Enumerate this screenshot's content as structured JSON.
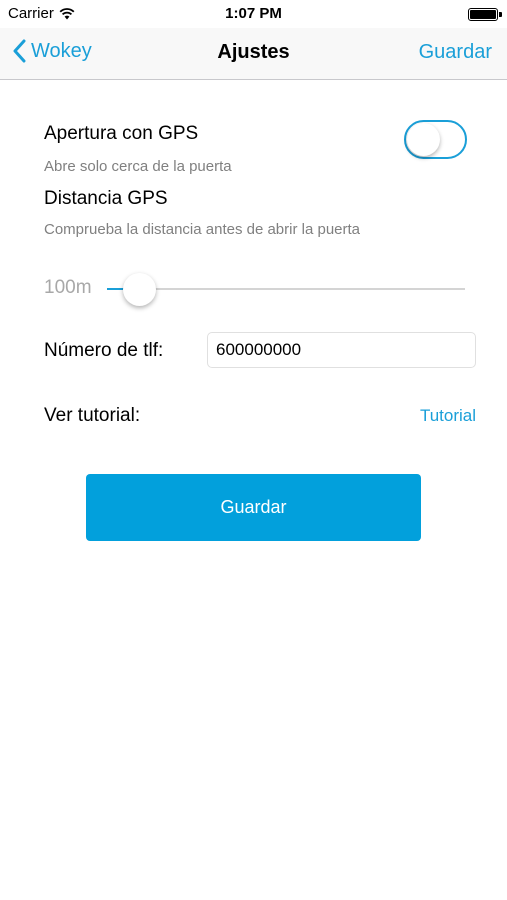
{
  "status_bar": {
    "carrier": "Carrier",
    "time": "1:07 PM",
    "icons": [
      "wifi-icon",
      "battery-icon"
    ]
  },
  "nav": {
    "back_label": "Wokey",
    "title": "Ajustes",
    "save_label": "Guardar"
  },
  "settings": {
    "gps_opening": {
      "label": "Apertura con GPS",
      "description": "Abre solo cerca de la puerta",
      "enabled": false
    },
    "gps_distance": {
      "label": "Distancia GPS",
      "description": "Comprueba la distancia antes de abrir la puerta",
      "value_label": "100m",
      "slider_fraction": 0.09
    },
    "phone": {
      "label": "Número de tlf:",
      "value": "600000000"
    },
    "tutorial": {
      "label": "Ver tutorial:",
      "link": "Tutorial"
    }
  },
  "main_button": {
    "label": "Guardar"
  },
  "colors": {
    "accent": "#1a9fd8",
    "button": "#02a0dc",
    "subtext": "#808080"
  }
}
